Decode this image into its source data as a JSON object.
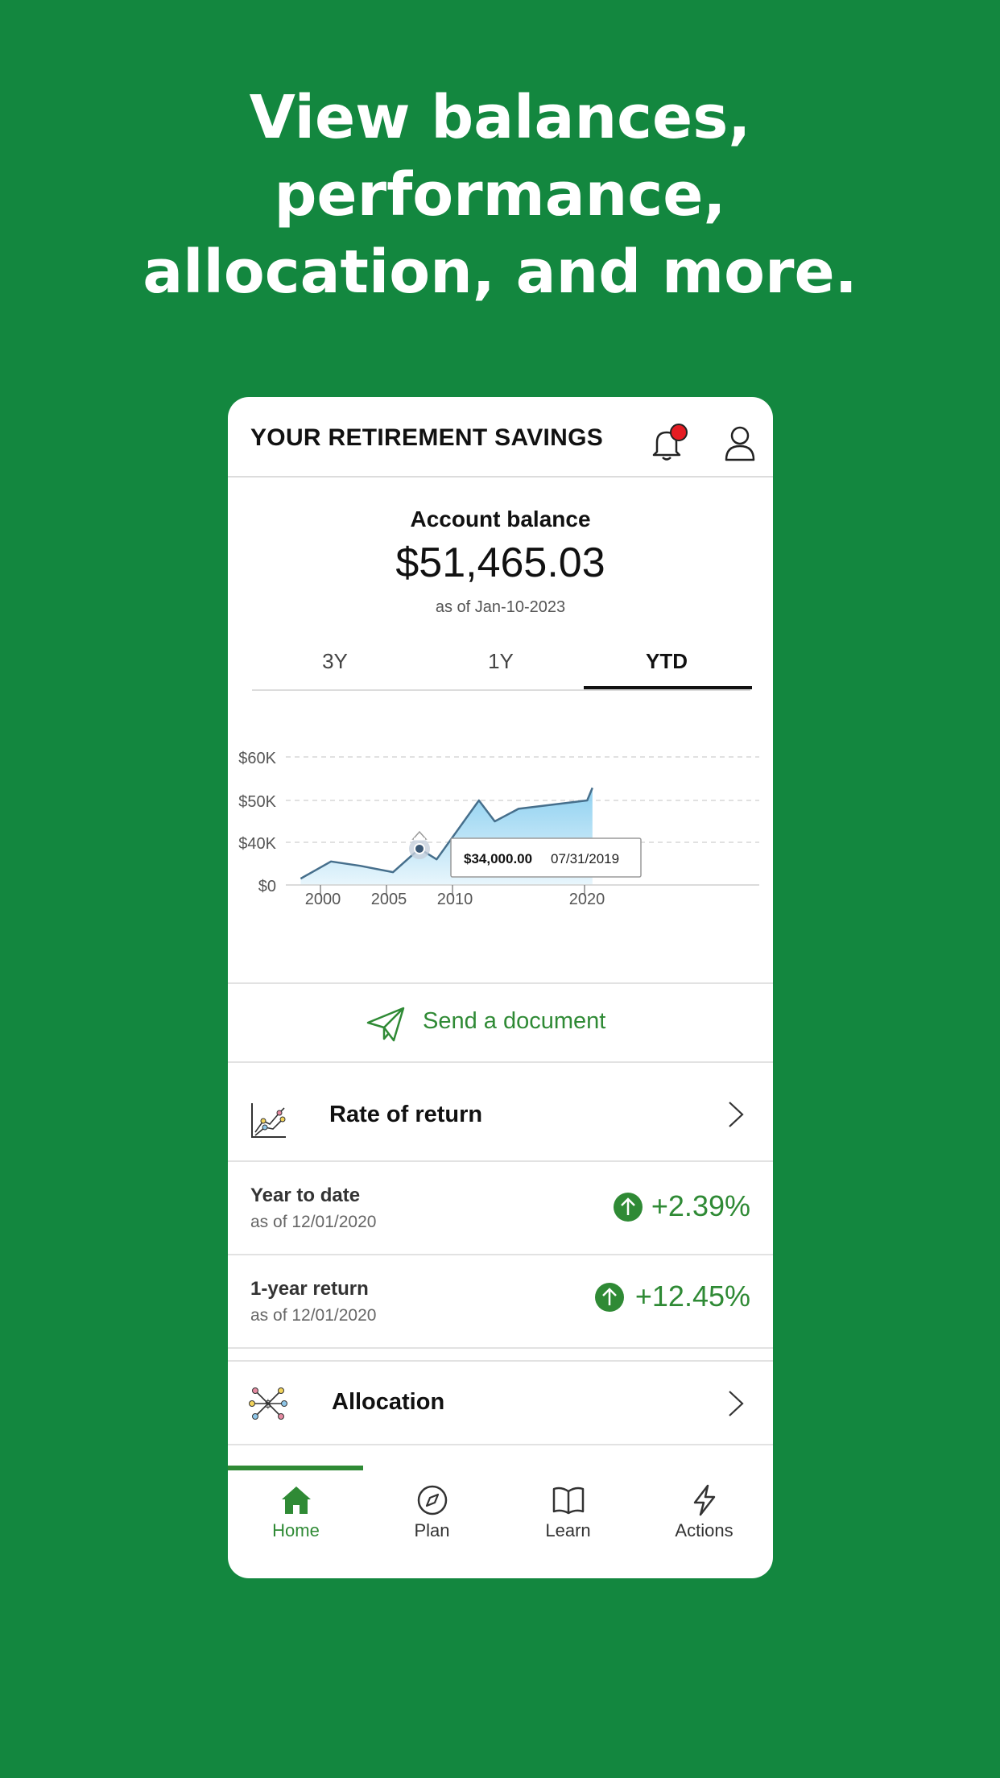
{
  "headline": {
    "line1": "View balances,",
    "line2": "performance,",
    "line3": "allocation, and more."
  },
  "header": {
    "title": "YOUR RETIREMENT SAVINGS",
    "notification_icon": "bell-icon",
    "profile_icon": "user-icon",
    "notification_dot_color": "#e51c23"
  },
  "balance": {
    "label": "Account balance",
    "value": "$51,465.03",
    "as_of": "as of Jan-10-2023"
  },
  "range_tabs": [
    {
      "label": "3Y",
      "active": false
    },
    {
      "label": "1Y",
      "active": false
    },
    {
      "label": "YTD",
      "active": true
    }
  ],
  "chart_data": {
    "type": "area",
    "x": [
      1998.5,
      2000.8,
      2003.0,
      2005.5,
      2007.5,
      2008.8,
      2012.0,
      2013.2,
      2015.0,
      2020.2,
      2020.6
    ],
    "y": [
      6000,
      22000,
      18000,
      12000,
      34000,
      24000,
      50000,
      45000,
      48000,
      50000,
      53000
    ],
    "xticks": [
      "2000",
      "2005",
      "2010",
      "2020"
    ],
    "yticks": [
      "$60K",
      "$50K",
      "$40K",
      "$0"
    ],
    "xlabel": "",
    "ylabel": "",
    "tooltip": {
      "value": "$34,000.00",
      "date": "07/31/2019"
    },
    "grid": true,
    "line_color": "#466f8c",
    "fill_color": "#a8dcf3"
  },
  "send_document": {
    "label": "Send a document",
    "icon": "paper-plane-icon",
    "color": "#2f8a35"
  },
  "rate_of_return": {
    "label": "Rate of return",
    "icon": "line-chart-icon"
  },
  "returns": [
    {
      "title": "Year to date",
      "as_of": "as of 12/01/2020",
      "value": "+2.39%"
    },
    {
      "title": "1-year return",
      "as_of": "as of 12/01/2020",
      "value": "+12.45%"
    }
  ],
  "allocation": {
    "label": "Allocation",
    "icon": "allocation-network-icon"
  },
  "nav": [
    {
      "label": "Home",
      "icon": "home-icon",
      "active": true
    },
    {
      "label": "Plan",
      "icon": "compass-icon",
      "active": false
    },
    {
      "label": "Learn",
      "icon": "book-icon",
      "active": false
    },
    {
      "label": "Actions",
      "icon": "lightning-icon",
      "active": false
    }
  ],
  "colors": {
    "background": "#13873f",
    "accent": "#2f8a35"
  }
}
